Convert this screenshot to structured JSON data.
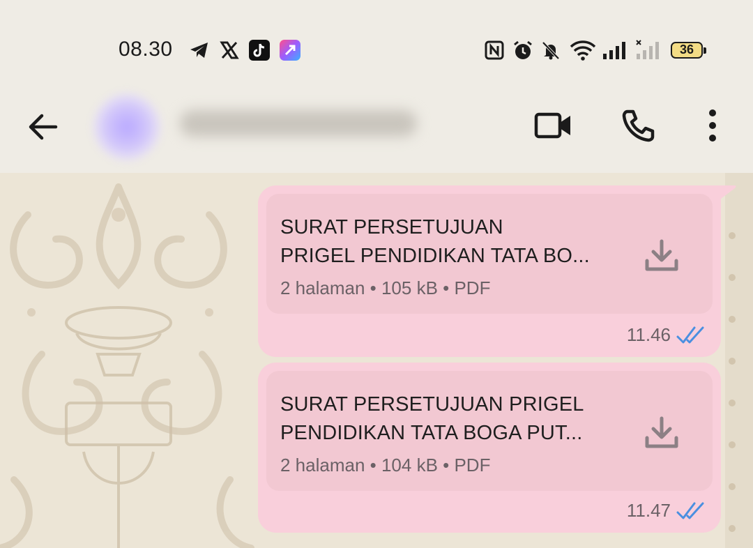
{
  "status_bar": {
    "time": "08.30",
    "left_icons": [
      "telegram-icon",
      "x-icon",
      "tiktok-icon",
      "shortcut-app-icon"
    ],
    "right_icons": [
      "nfc-icon",
      "alarm-icon",
      "mute-icon",
      "wifi-icon",
      "signal-icon",
      "signal-no-service-icon"
    ],
    "battery_level": "36"
  },
  "header": {
    "contact_name": "",
    "video_call_icon": "video-camera-icon",
    "voice_call_icon": "phone-icon",
    "menu_icon": "more-vertical-icon"
  },
  "messages": [
    {
      "title_line1": "SURAT PERSETUJUAN",
      "title_line2": "PRIGEL PENDIDIKAN TATA BO...",
      "meta": "2 halaman • 105 kB • PDF",
      "time": "11.46",
      "status": "read"
    },
    {
      "title_line1": "SURAT PERSETUJUAN PRIGEL",
      "title_line2": "PENDIDIKAN TATA BOGA PUT...",
      "meta": "2 halaman • 104 kB • PDF",
      "time": "11.47",
      "status": "read"
    }
  ],
  "colors": {
    "bubble": "#f9cfdb",
    "doc_card": "#f2c8d2",
    "read_tick": "#4a8fe0",
    "bar_bg": "#efece5"
  }
}
